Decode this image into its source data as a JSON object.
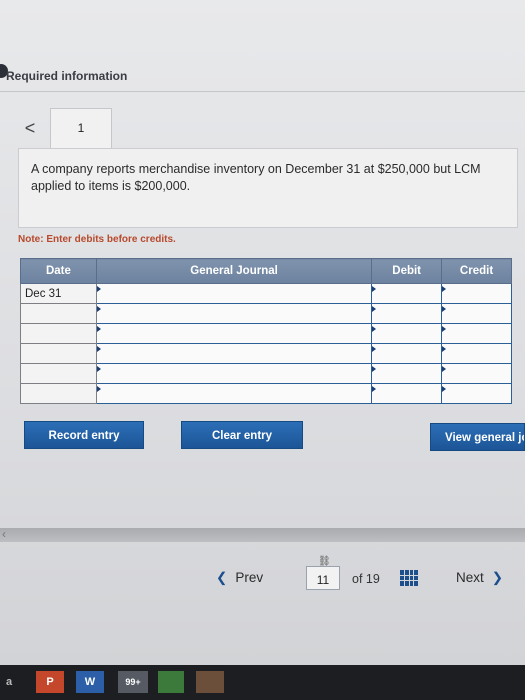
{
  "header": {
    "required_label": "Required information"
  },
  "tabs": {
    "prev_symbol": "<",
    "current": "1"
  },
  "question": {
    "text": "A company reports merchandise inventory on December 31 at $250,000 but LCM applied to items is $200,000."
  },
  "note": "Note: Enter debits before credits.",
  "journal": {
    "headers": [
      "Date",
      "General Journal",
      "Debit",
      "Credit"
    ],
    "rows": [
      {
        "date": "Dec 31",
        "account": "",
        "debit": "",
        "credit": ""
      },
      {
        "date": "",
        "account": "",
        "debit": "",
        "credit": ""
      },
      {
        "date": "",
        "account": "",
        "debit": "",
        "credit": ""
      },
      {
        "date": "",
        "account": "",
        "debit": "",
        "credit": ""
      },
      {
        "date": "",
        "account": "",
        "debit": "",
        "credit": ""
      },
      {
        "date": "",
        "account": "",
        "debit": "",
        "credit": ""
      }
    ]
  },
  "buttons": {
    "record": "Record entry",
    "clear": "Clear entry",
    "view": "View general jou"
  },
  "pager": {
    "prev": "Prev",
    "current_page": "11",
    "of_text": "of 19",
    "next": "Next"
  },
  "taskbar": {
    "items": [
      "P",
      "W",
      "99+"
    ]
  },
  "colors": {
    "button_blue": "#1c5597",
    "header_blue": "#6d829f",
    "note_red": "#b8492c"
  }
}
